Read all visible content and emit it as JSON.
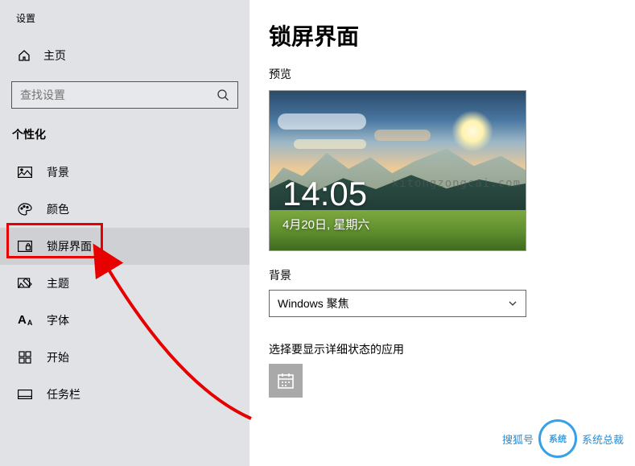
{
  "sidebar": {
    "app_title": "设置",
    "home_label": "主页",
    "search_placeholder": "查找设置",
    "section_label": "个性化",
    "items": [
      {
        "label": "背景"
      },
      {
        "label": "颜色"
      },
      {
        "label": "锁屏界面"
      },
      {
        "label": "主题"
      },
      {
        "label": "字体"
      },
      {
        "label": "开始"
      },
      {
        "label": "任务栏"
      }
    ]
  },
  "main": {
    "heading": "锁屏界面",
    "preview_label": "预览",
    "preview_time": "14:05",
    "preview_date": "4月20日, 星期六",
    "preview_watermark": "xitongzongcai.com",
    "bg_section_label": "背景",
    "bg_dropdown_value": "Windows 聚焦",
    "detail_app_label": "选择要显示详细状态的应用"
  },
  "watermark": {
    "brand_prefix": "搜狐号",
    "brand_circle": "系统",
    "brand_suffix": "系统总裁"
  }
}
